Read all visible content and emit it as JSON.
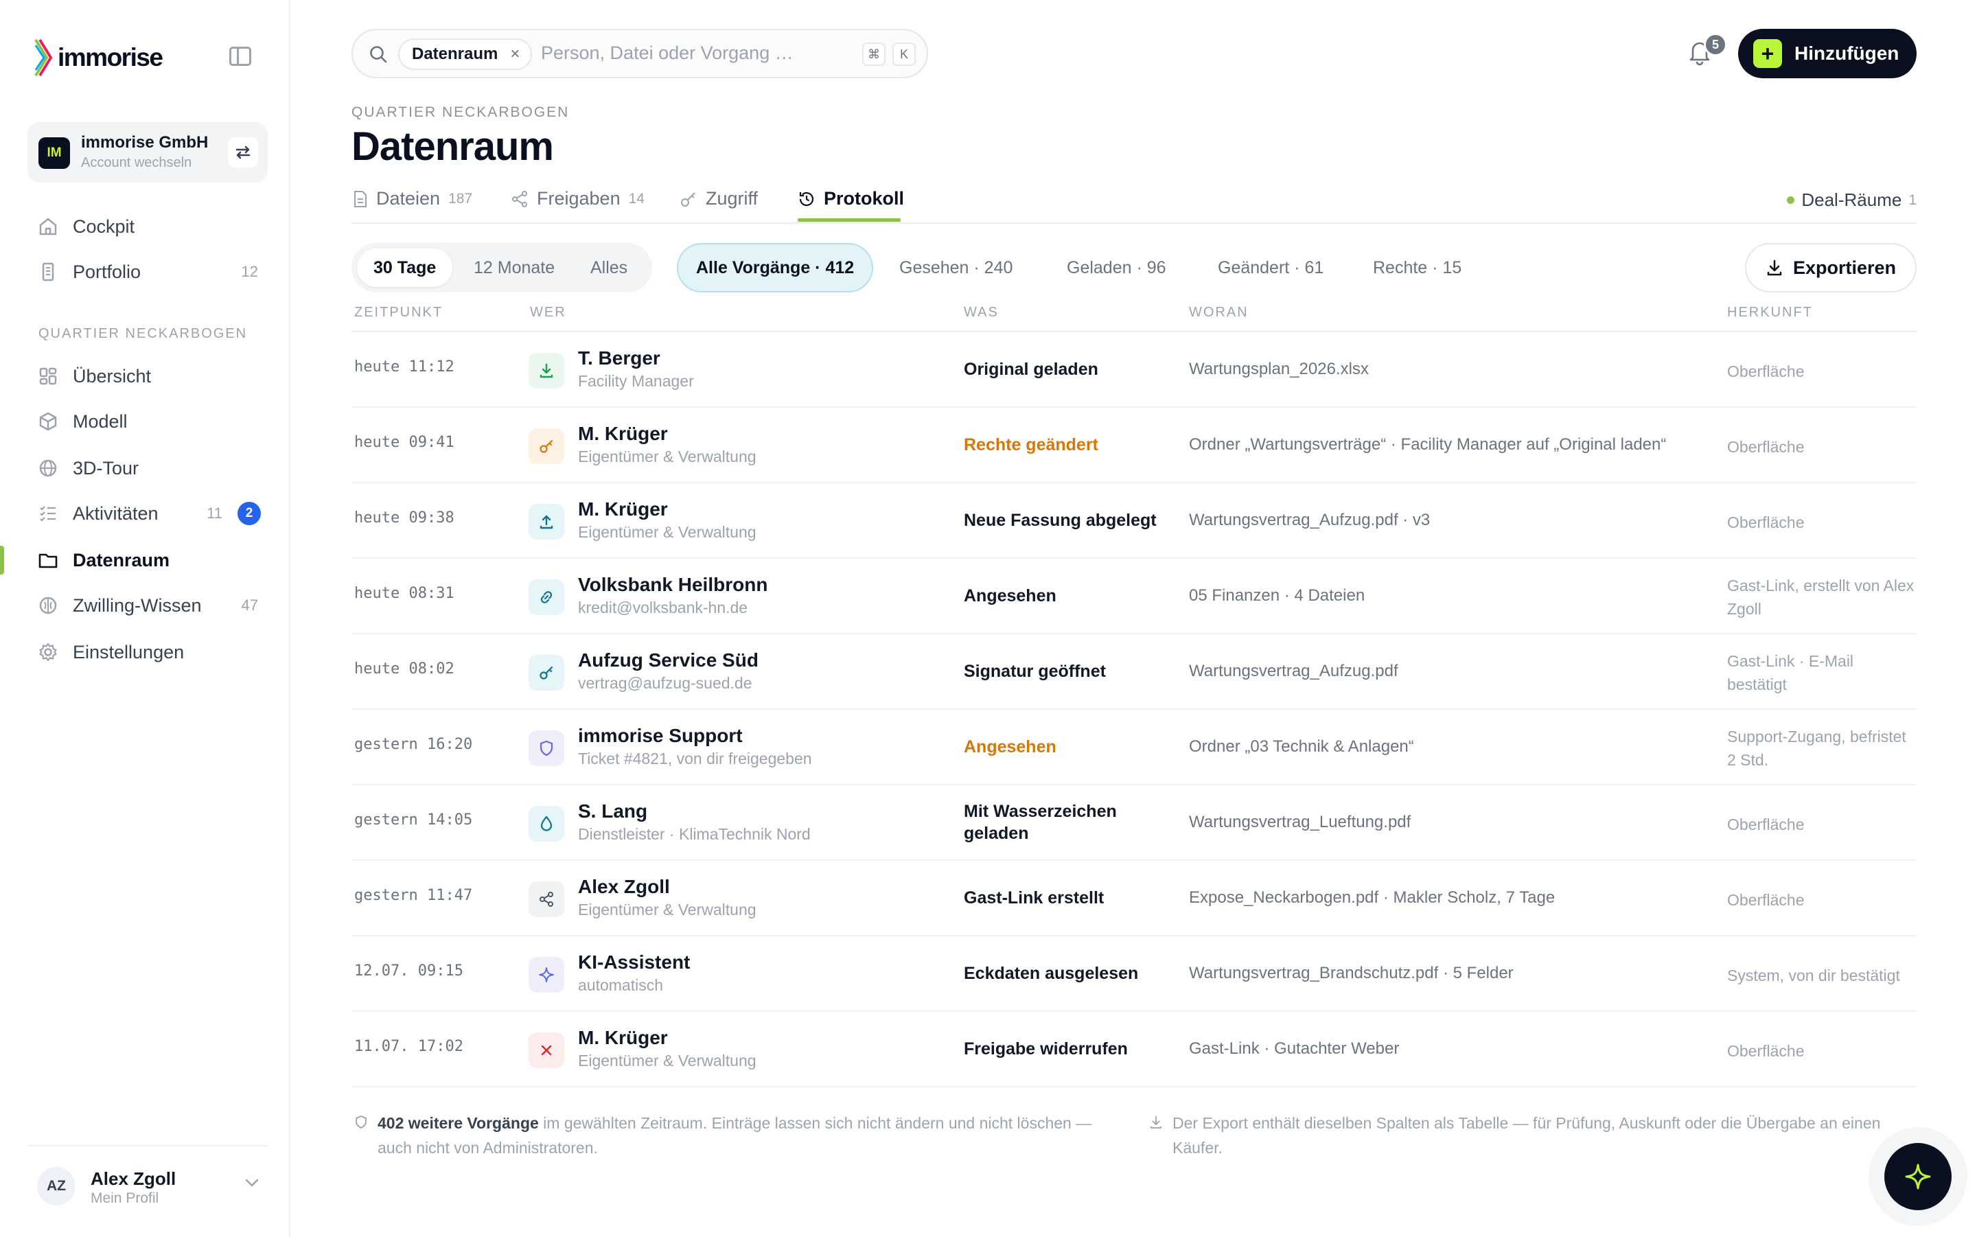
{
  "brand": {
    "name": "immorise"
  },
  "account": {
    "initials": "IM",
    "name": "immorise GmbH",
    "sub": "Account wechseln"
  },
  "nav_top": [
    {
      "label": "Cockpit",
      "count": ""
    },
    {
      "label": "Portfolio",
      "count": "12"
    }
  ],
  "section_label": "QUARTIER NECKARBOGEN",
  "nav_project": [
    {
      "label": "Übersicht",
      "count": ""
    },
    {
      "label": "Modell",
      "count": ""
    },
    {
      "label": "3D-Tour",
      "count": ""
    },
    {
      "label": "Aktivitäten",
      "count": "11",
      "badge": "2"
    },
    {
      "label": "Datenraum",
      "count": ""
    },
    {
      "label": "Zwilling-Wissen",
      "count": "47"
    },
    {
      "label": "Einstellungen",
      "count": ""
    }
  ],
  "user": {
    "initials": "AZ",
    "name": "Alex Zgoll",
    "sub": "Mein Profil"
  },
  "search": {
    "chip": "Datenraum",
    "chip_remove": "×",
    "placeholder": "Person, Datei oder Vorgang …",
    "kbd1": "⌘",
    "kbd2": "K"
  },
  "notifications": {
    "count": "5"
  },
  "add_button": {
    "label": "Hinzufügen",
    "icon": "+"
  },
  "header": {
    "kicker": "QUARTIER NECKARBOGEN",
    "title": "Datenraum"
  },
  "tabs": [
    {
      "label": "Dateien",
      "count": "187"
    },
    {
      "label": "Freigaben",
      "count": "14"
    },
    {
      "label": "Zugriff",
      "count": ""
    },
    {
      "label": "Protokoll",
      "count": ""
    }
  ],
  "deal_rooms": {
    "label": "Deal-Räume",
    "count": "1"
  },
  "time_range": [
    "30 Tage",
    "12 Monate",
    "Alles"
  ],
  "filters": [
    "Alle Vorgänge · 412",
    "Gesehen · 240",
    "Geladen · 96",
    "Geändert · 61",
    "Rechte · 15"
  ],
  "export": {
    "label": "Exportieren"
  },
  "columns": {
    "time": "ZEITPUNKT",
    "who": "WER",
    "what": "WAS",
    "where": "WORAN",
    "origin": "HERKUNFT"
  },
  "rows": [
    {
      "time": "heute 11:12",
      "icon": "download-icon",
      "who": "T. Berger",
      "role": "Facility Manager",
      "what": "Original geladen",
      "where": "Wartungsplan_2026.xlsx",
      "origin": "Oberfläche"
    },
    {
      "time": "heute 09:41",
      "icon": "key-icon",
      "who": "M. Krüger",
      "role": "Eigentümer & Verwaltung",
      "what": "Rechte geändert",
      "where": "Ordner „Wartungsverträge“ · Facility Manager auf „Original laden“",
      "origin": "Oberfläche"
    },
    {
      "time": "heute 09:38",
      "icon": "upload-icon",
      "who": "M. Krüger",
      "role": "Eigentümer & Verwaltung",
      "what": "Neue Fassung abgelegt",
      "where": "Wartungsvertrag_Aufzug.pdf · v3",
      "origin": "Oberfläche"
    },
    {
      "time": "heute 08:31",
      "icon": "link-icon",
      "who": "Volksbank Heilbronn",
      "role": "kredit@volksbank-hn.de",
      "what": "Angesehen",
      "where": "05 Finanzen · 4 Dateien",
      "origin": "Gast-Link, erstellt von Alex Zgoll"
    },
    {
      "time": "heute 08:02",
      "icon": "key-icon",
      "who": "Aufzug Service Süd",
      "role": "vertrag@aufzug-sued.de",
      "what": "Signatur geöffnet",
      "where": "Wartungsvertrag_Aufzug.pdf",
      "origin": "Gast-Link · E-Mail bestätigt"
    },
    {
      "time": "gestern 16:20",
      "icon": "shield-icon",
      "who": "immorise Support",
      "role": "Ticket #4821, von dir freigegeben",
      "what": "Angesehen",
      "where": "Ordner „03 Technik & Anlagen“",
      "origin": "Support-Zugang, befristet 2 Std."
    },
    {
      "time": "gestern 14:05",
      "icon": "drop-icon",
      "who": "S. Lang",
      "role": "Dienstleister · KlimaTechnik Nord",
      "what": "Mit Wasserzeichen geladen",
      "where": "Wartungsvertrag_Lueftung.pdf",
      "origin": "Oberfläche"
    },
    {
      "time": "gestern 11:47",
      "icon": "share-icon",
      "who": "Alex Zgoll",
      "role": "Eigentümer & Verwaltung",
      "what": "Gast-Link erstellt",
      "where": "Expose_Neckarbogen.pdf · Makler Scholz, 7 Tage",
      "origin": "Oberfläche"
    },
    {
      "time": "12.07. 09:15",
      "icon": "sparkle-icon",
      "who": "KI-Assistent",
      "role": "automatisch",
      "what": "Eckdaten ausgelesen",
      "where": "Wartungsvertrag_Brandschutz.pdf · 5 Felder",
      "origin": "System, von dir bestätigt"
    },
    {
      "time": "11.07. 17:02",
      "icon": "x-icon",
      "who": "M. Krüger",
      "role": "Eigentümer & Verwaltung",
      "what": "Freigabe widerrufen",
      "where": "Gast-Link · Gutachter Weber",
      "origin": "Oberfläche"
    }
  ],
  "footnote_left": {
    "bold": "402 weitere Vorgänge",
    "text": " im gewählten Zeitraum. Einträge lassen sich nicht ändern und nicht löschen — auch nicht von Administratoren."
  },
  "footnote_right": {
    "text": "Der Export enthält dieselben Spalten als Tabelle — für Prüfung, Auskunft oder die Übergabe an einen Käufer."
  },
  "colors": {
    "accent": "#8bc34a",
    "dark": "#0b1020",
    "lime": "#b9f63a",
    "orange": "#d97706",
    "blue_badge": "#2563eb"
  }
}
